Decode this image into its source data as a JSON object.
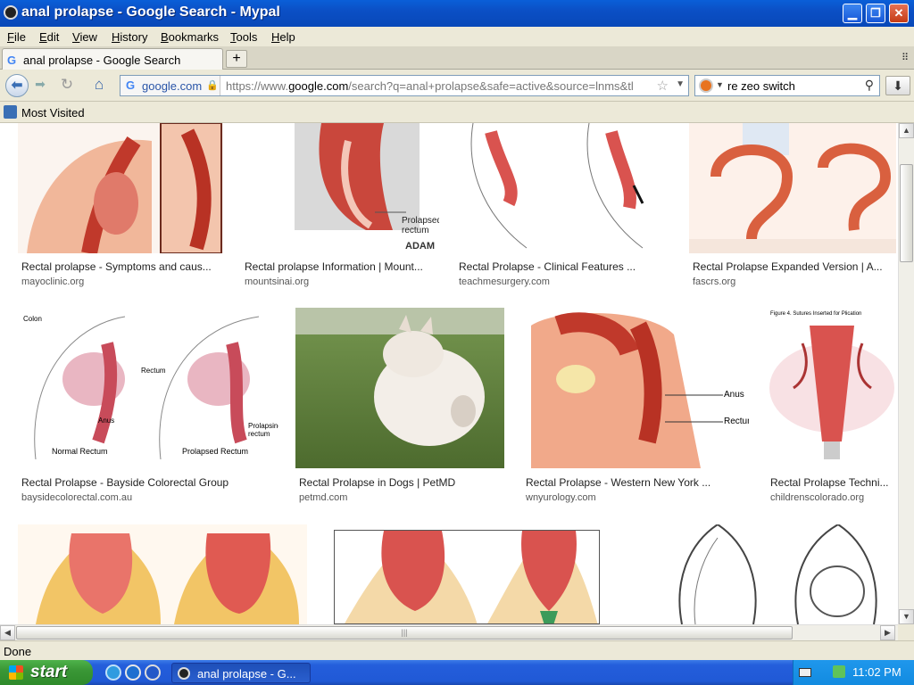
{
  "window": {
    "title": "anal prolapse - Google Search - Mypal",
    "controls": {
      "minimize": "▁",
      "maximize": "❐",
      "close": "✕"
    }
  },
  "menu": {
    "file": {
      "ul": "F",
      "rest": "ile"
    },
    "edit": {
      "ul": "E",
      "rest": "dit"
    },
    "view": {
      "ul": "V",
      "rest": "iew"
    },
    "history": {
      "ul": "H",
      "rest": "istory"
    },
    "bookmarks": {
      "ul": "B",
      "rest": "ookmarks"
    },
    "tools": {
      "ul": "T",
      "rest": "ools"
    },
    "help": {
      "ul": "H",
      "rest": "elp"
    }
  },
  "tabs": [
    {
      "label": "anal prolapse - Google Search",
      "favicon": "G"
    }
  ],
  "tab_controls": {
    "new_tab": "+",
    "tab_list": "⠿"
  },
  "nav": {
    "back": "⬅",
    "forward": "➡",
    "reload": "↻",
    "home": "⌂",
    "identity_domain": "google.com",
    "url_prefix": "https://www.",
    "url_host": "google.com",
    "url_rest": "/search?q=anal+prolapse&safe=active&source=lnms&tl",
    "search_query": "re zeo switch",
    "download": "⬇"
  },
  "bookmarks_toolbar": {
    "label": "Most Visited"
  },
  "results": [
    {
      "caption": "Rectal prolapse - Symptoms and caus...",
      "source": "mayoclinic.org",
      "variant": "clinic"
    },
    {
      "caption": "Rectal prolapse Information | Mount...",
      "source": "mountsinai.org",
      "variant": "adam",
      "overlay": "ADAM"
    },
    {
      "caption": "Rectal Prolapse - Clinical Features ...",
      "source": "teachmesurgery.com",
      "variant": "sketch"
    },
    {
      "caption": "Rectal Prolapse Expanded Version | A...",
      "source": "fascrs.org",
      "variant": "colon"
    },
    {
      "caption": "Rectal Prolapse - Bayside Colorectal Group",
      "source": "baysidecolorectal.com.au",
      "variant": "bayside"
    },
    {
      "caption": "Rectal Prolapse in Dogs | PetMD",
      "source": "petmd.com",
      "variant": "dog"
    },
    {
      "caption": "Rectal Prolapse - Western New York ...",
      "source": "wnyurology.com",
      "variant": "wny"
    },
    {
      "caption": "Rectal Prolapse Techni...",
      "source": "childrenscolorado.org",
      "variant": "sutures",
      "overlay": "Figure 4. Sutures Inserted for Plication"
    },
    {
      "caption": "",
      "source": "",
      "variant": "red"
    },
    {
      "caption": "",
      "source": "",
      "variant": "red2"
    },
    {
      "caption": "",
      "source": "",
      "variant": "lineart"
    }
  ],
  "status": {
    "text": "Done"
  },
  "taskbar": {
    "start_label": "start",
    "task_label": "anal prolapse - G...",
    "clock": "11:02 PM"
  },
  "colors": {
    "titlebar": "#0b4fc5",
    "taskbar": "#245edb",
    "start": "#3a9736",
    "tray": "#128be0"
  }
}
